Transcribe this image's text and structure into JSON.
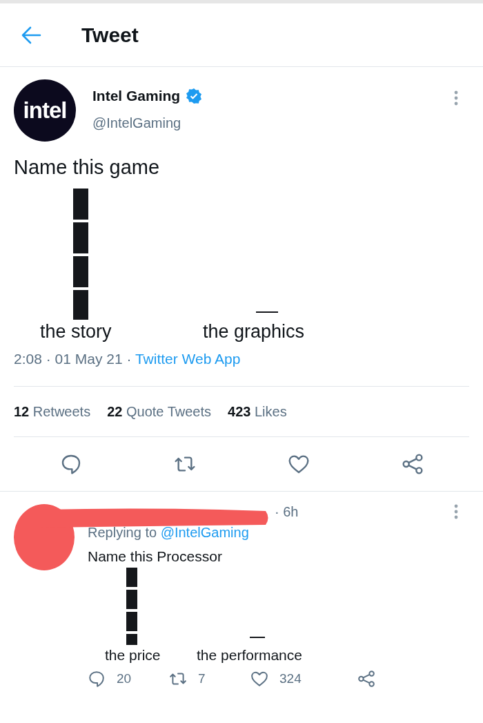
{
  "header": {
    "title": "Tweet"
  },
  "tweet": {
    "logo_text": "intel",
    "name": "Intel Gaming",
    "verified": true,
    "handle": "@IntelGaming",
    "text": "Name this game",
    "chart_labels": [
      "the story",
      "the graphics"
    ],
    "time": "2:08 · 01 May 21",
    "separator": "·",
    "source": "Twitter Web App",
    "stats": [
      {
        "count": "12",
        "label": "Retweets"
      },
      {
        "count": "22",
        "label": "Quote Tweets"
      },
      {
        "count": "423",
        "label": "Likes"
      }
    ]
  },
  "reply": {
    "time": "· 6h",
    "replying_prefix": "Replying to",
    "replying_handle": "@IntelGaming",
    "text": "Name this Processor",
    "chart_labels": [
      "the price",
      "the performance"
    ],
    "actions": [
      {
        "kind": "reply",
        "count": "20"
      },
      {
        "kind": "retweet",
        "count": "7"
      },
      {
        "kind": "like",
        "count": "324"
      },
      {
        "kind": "share"
      }
    ]
  }
}
